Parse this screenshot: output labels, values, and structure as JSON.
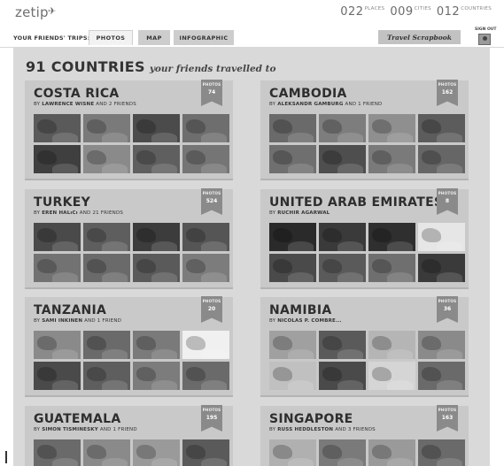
{
  "app": {
    "logo": "zetip",
    "logo_icon": "plane-icon",
    "stats": [
      {
        "value": "022",
        "label": "PLACES"
      },
      {
        "value": "009",
        "label": "CITIES"
      },
      {
        "value": "012",
        "label": "COUNTRIES"
      }
    ]
  },
  "nav": {
    "label": "YOUR FRIENDS' TRIPS:",
    "tabs": [
      {
        "label": "PHOTOS",
        "active": true
      },
      {
        "label": "MAP",
        "active": false
      },
      {
        "label": "INFOGRAPHIC",
        "active": false
      }
    ],
    "scrapbook": "Travel Scrapbook",
    "signout": "SIGN OUT"
  },
  "heading": {
    "main": "91 COUNTRIES",
    "script": "your friends travelled to"
  },
  "badge_label": "PHOTOS",
  "cards": [
    {
      "country": "COSTA RICA",
      "by": "BY",
      "person": "LAWRENCE WISNE",
      "suffix": "AND 2 FRIENDS",
      "photos": "74",
      "tones": [
        "#5a5a5a",
        "#7a7a7a",
        "#4b4b4b",
        "#6e6e6e",
        "#3f3f3f",
        "#8a8a8a",
        "#5f5f5f",
        "#757575"
      ]
    },
    {
      "country": "CAMBODIA",
      "by": "BY",
      "person": "ALEKSANDR GAMBURG",
      "suffix": "AND 1 FRIEND",
      "photos": "162",
      "tones": [
        "#6a6a6a",
        "#7d7d7d",
        "#8f8f8f",
        "#5c5c5c",
        "#6f6f6f",
        "#4e4e4e",
        "#7a7a7a",
        "#666666"
      ]
    },
    {
      "country": "TURKEY",
      "by": "BY",
      "person": "EREN HALıCı",
      "suffix": "AND 21 FRIENDS",
      "photos": "524",
      "tones": [
        "#4a4a4a",
        "#5e5e5e",
        "#3c3c3c",
        "#555555",
        "#727272",
        "#6a6a6a",
        "#5a5a5a",
        "#7c7c7c"
      ]
    },
    {
      "country": "UNITED ARAB EMIRATES",
      "by": "BY",
      "person": "RUCHIR AGARWAL",
      "suffix": "",
      "photos": "8",
      "tones": [
        "#2a2a2a",
        "#3a3a3a",
        "#2f2f2f",
        "#e6e6e6",
        "#4a4a4a",
        "#5a5a5a",
        "#6f6f6f",
        "#3a3a3a"
      ]
    },
    {
      "country": "TANZANIA",
      "by": "BY",
      "person": "SAMI INKINEN",
      "suffix": "AND 1 FRIEND",
      "photos": "20",
      "tones": [
        "#8a8a8a",
        "#6a6a6a",
        "#7a7a7a",
        "#f0f0f0",
        "#4a4a4a",
        "#5e5e5e",
        "#7c7c7c",
        "#6a6a6a"
      ]
    },
    {
      "country": "NAMIBIA",
      "by": "BY",
      "person": "NICOLAS P. COMBRE...",
      "suffix": "",
      "photos": "36",
      "tones": [
        "#a0a0a0",
        "#5a5a5a",
        "#b5b5b5",
        "#8a8a8a",
        "#c0c0c0",
        "#4a4a4a",
        "#d5d5d5",
        "#6a6a6a"
      ]
    },
    {
      "country": "GUATEMALA",
      "by": "BY",
      "person": "SIMON TISMINESKY",
      "suffix": "AND 1 FRIEND",
      "photos": "195",
      "tones": [
        "#6a6a6a",
        "#8a8a8a",
        "#9a9a9a",
        "#5a5a5a"
      ]
    },
    {
      "country": "SINGAPORE",
      "by": "BY",
      "person": "RUSS HEDDLESTON",
      "suffix": "AND 3 FRIENDS",
      "photos": "163",
      "tones": [
        "#b0b0b0",
        "#7a7a7a",
        "#9a9a9a",
        "#6a6a6a"
      ]
    }
  ]
}
